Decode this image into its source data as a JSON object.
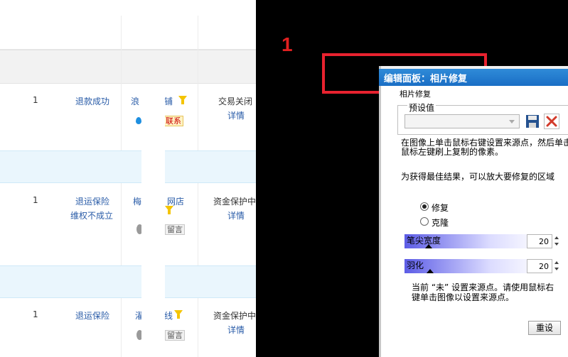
{
  "annotation": {
    "step_number": "1"
  },
  "orders": [
    {
      "qty": "1",
      "refund_status": "退款成功",
      "refund_sub": "",
      "shop_part_a": "浪",
      "shop_part_b": "铺",
      "badge": "联系",
      "trade_status": "交易关闭",
      "detail": "详情"
    },
    {
      "qty": "1",
      "refund_status": "退运保险",
      "refund_sub": "维权不成立",
      "shop_part_a": "梅",
      "shop_part_b": "网店",
      "badge": "留言",
      "trade_status": "资金保护中",
      "detail": "详情"
    },
    {
      "qty": "1",
      "refund_status": "退运保险",
      "refund_sub": "",
      "shop_part_a": "濯",
      "shop_part_b": "线",
      "badge": "留言",
      "trade_status": "资金保护中",
      "detail": "详情"
    }
  ],
  "panel": {
    "title": "编辑面板：相片修复",
    "section_label": "相片修复",
    "preset_label": "预设值",
    "preset_value": "",
    "instruction": "在图像上单击鼠标右键设置来源点，然后单击",
    "instruction_line2": "鼠标左键刷上复制的像素。",
    "tip": "为获得最佳结果，可以放大要修复的区域",
    "mode_options": [
      "修复",
      "克隆"
    ],
    "mode_selected": "修复",
    "brush_width_label": "笔尖宽度",
    "brush_width_value": "20",
    "feather_label": "羽化",
    "feather_value": "20",
    "source_status_line1": "当前 “未” 设置来源点。请使用鼠标右",
    "source_status_line2": "键单击图像以设置来源点。",
    "reset_label": "重设"
  },
  "colors": {
    "accent_red": "#e8222f",
    "link_blue": "#2a5ca8",
    "title_blue": "#1a6ec5"
  }
}
